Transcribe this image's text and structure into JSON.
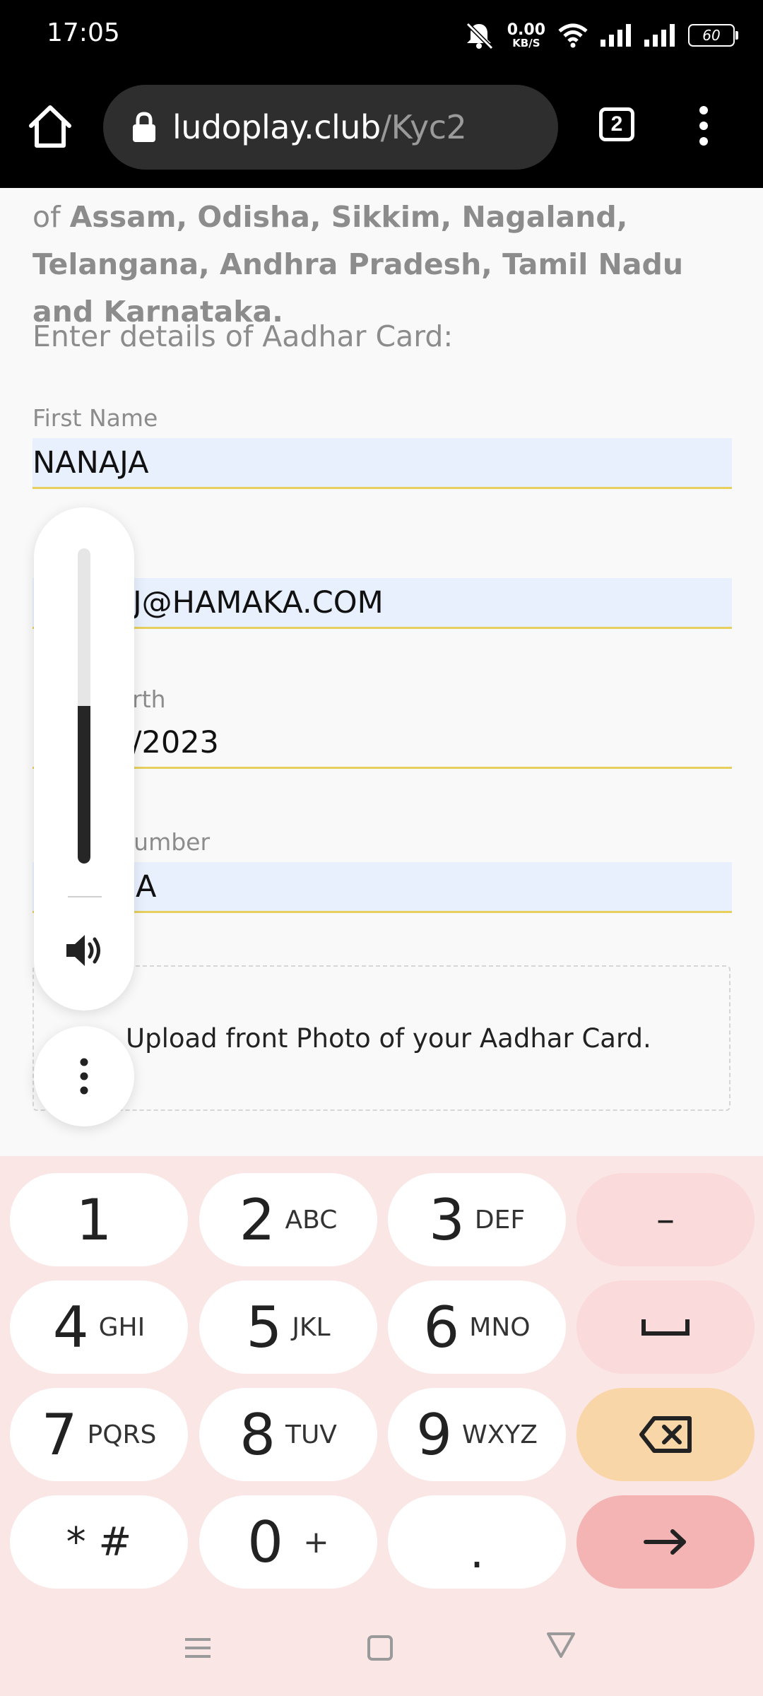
{
  "status_bar": {
    "time": "17:05",
    "net_speed_value": "0.00",
    "net_speed_unit": "KB/S",
    "battery": "60",
    "icons": [
      "mute-icon",
      "wifi-icon",
      "signal-icon",
      "signal-icon",
      "battery-icon"
    ]
  },
  "browser": {
    "url_host": "ludoplay.club",
    "url_path": "/Kyc2",
    "tab_count": "2"
  },
  "page": {
    "intro_prefix": "of ",
    "intro_states": "Assam, Odisha, Sikkim, Nagaland, Telangana, Andhra Pradesh, Tamil Nadu and Karnataka.",
    "section_label": "Enter details of Aadhar Card:",
    "first_name_label": "First Name",
    "first_name_value": "NANAJA",
    "email_value": "J@HAMAKA.COM",
    "dob_label_fragment": "irth",
    "dob_value_fragment": "/2023",
    "aadhar_label_fragment": "lumber",
    "aadhar_value_fragment": "A",
    "upload_text": "Upload front Photo of your Aadhar Card."
  },
  "volume": {
    "level_fraction": 0.5
  },
  "keyboard": {
    "rows": [
      [
        {
          "digit": "1",
          "letters": ""
        },
        {
          "digit": "2",
          "letters": "ABC"
        },
        {
          "digit": "3",
          "letters": "DEF"
        }
      ],
      [
        {
          "digit": "4",
          "letters": "GHI"
        },
        {
          "digit": "5",
          "letters": "JKL"
        },
        {
          "digit": "6",
          "letters": "MNO"
        }
      ],
      [
        {
          "digit": "7",
          "letters": "PQRS"
        },
        {
          "digit": "8",
          "letters": "TUV"
        },
        {
          "digit": "9",
          "letters": "WXYZ"
        }
      ],
      [
        {
          "digit": "* #",
          "letters": ""
        },
        {
          "digit": "0",
          "letters": "+"
        },
        {
          "digit": ".",
          "letters": ""
        }
      ]
    ],
    "minus_key": "–",
    "colors": {
      "background": "#fbe6e6",
      "action_key": "#fadada",
      "delete_key": "#f9d6a8",
      "enter_key": "#f5b4b4"
    }
  },
  "nav_bar": {
    "icons": [
      "menu-icon",
      "home-square-icon",
      "back-triangle-icon"
    ]
  }
}
